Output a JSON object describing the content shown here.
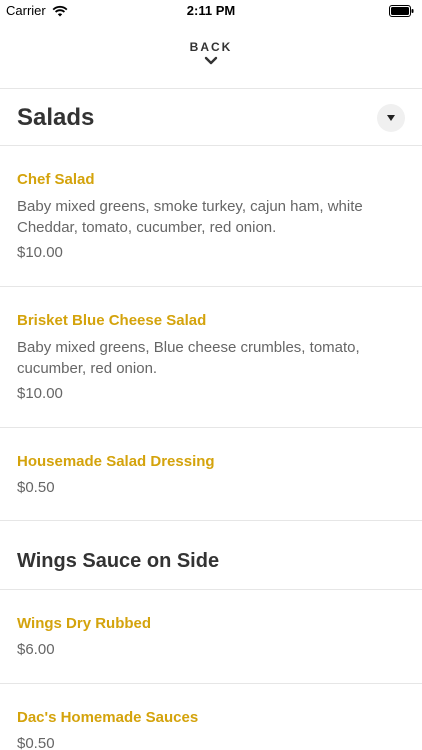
{
  "status_bar": {
    "carrier": "Carrier",
    "time": "2:11 PM"
  },
  "nav": {
    "back_label": "BACK"
  },
  "sections": [
    {
      "title": "Salads",
      "items": [
        {
          "name": "Chef Salad",
          "description": "Baby mixed greens, smoke turkey, cajun ham, white Cheddar, tomato, cucumber, red onion.",
          "price": "$10.00"
        },
        {
          "name": "Brisket Blue Cheese Salad",
          "description": "Baby mixed greens, Blue cheese crumbles, tomato, cucumber, red onion.",
          "price": "$10.00"
        },
        {
          "name": "Housemade Salad Dressing",
          "price": "$0.50"
        }
      ]
    },
    {
      "title": "Wings Sauce on Side",
      "items": [
        {
          "name": "Wings Dry Rubbed",
          "price": "$6.00"
        },
        {
          "name": "Dac's Homemade Sauces",
          "price": "$0.50"
        }
      ]
    }
  ]
}
